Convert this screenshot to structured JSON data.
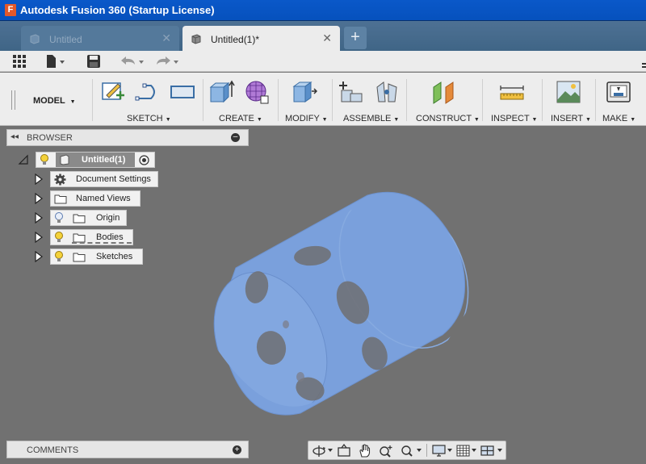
{
  "window": {
    "title": "Autodesk Fusion 360 (Startup License)",
    "app_icon_letter": "F"
  },
  "tabs": [
    {
      "label": "Untitled",
      "active": false,
      "close": "✕"
    },
    {
      "label": "Untitled(1)*",
      "active": true,
      "close": "✕"
    }
  ],
  "tab_add": "+",
  "ribbon": {
    "workspace": "MODEL",
    "groups": [
      {
        "label": "SKETCH",
        "caret": "▼"
      },
      {
        "label": "CREATE",
        "caret": "▼"
      },
      {
        "label": "MODIFY",
        "caret": "▼"
      },
      {
        "label": "ASSEMBLE",
        "caret": "▼"
      },
      {
        "label": "CONSTRUCT",
        "caret": "▼"
      },
      {
        "label": "INSPECT",
        "caret": "▼"
      },
      {
        "label": "INSERT",
        "caret": "▼"
      },
      {
        "label": "MAKE",
        "caret": "▼"
      }
    ]
  },
  "browser": {
    "title": "BROWSER",
    "root": "Untitled(1)",
    "items": [
      {
        "label": "Document Settings",
        "icon": "gear-icon"
      },
      {
        "label": "Named Views",
        "icon": "folder-icon"
      },
      {
        "label": "Origin",
        "icon": "folder-icon"
      },
      {
        "label": "Bodies",
        "icon": "folder-icon"
      },
      {
        "label": "Sketches",
        "icon": "folder-icon"
      }
    ]
  },
  "comments": {
    "title": "COMMENTS"
  },
  "colors": {
    "titlebar": "#0651bd",
    "viewport_bg": "#717171",
    "body_fill": "#7aa0dc",
    "panel": "#ececec"
  }
}
